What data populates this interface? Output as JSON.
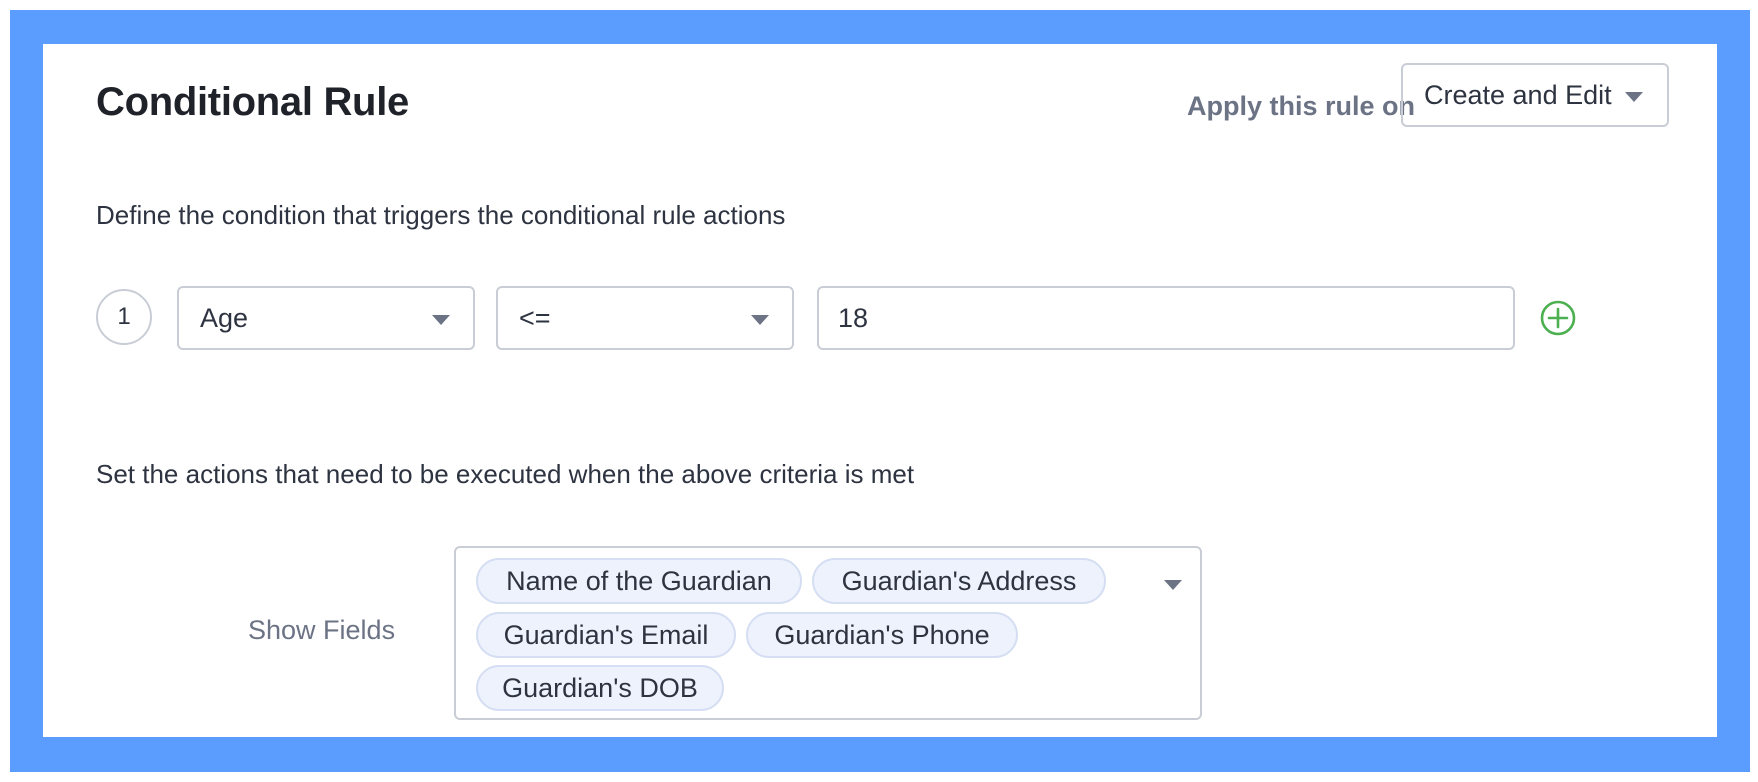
{
  "header": {
    "title": "Conditional Rule",
    "apply_label": "Apply this rule on",
    "apply_value": "Create and Edit"
  },
  "condition": {
    "description": "Define the condition that triggers the conditional rule actions",
    "rules": [
      {
        "number": "1",
        "field": "Age",
        "operator": "<=",
        "value": "18"
      }
    ]
  },
  "actions": {
    "description": "Set the actions that need to be executed when the above criteria is met",
    "show_fields_label": "Show Fields",
    "fields": [
      "Name of the Guardian",
      "Guardian's Address",
      "Guardian's Email",
      "Guardian's Phone",
      "Guardian's DOB"
    ]
  },
  "colors": {
    "frame": "#5b9cff",
    "add_icon": "#4caf50",
    "tag_bg": "#eef2fc"
  },
  "icons": {
    "add": "plus-circle-icon",
    "dropdown": "caret-down-icon"
  }
}
